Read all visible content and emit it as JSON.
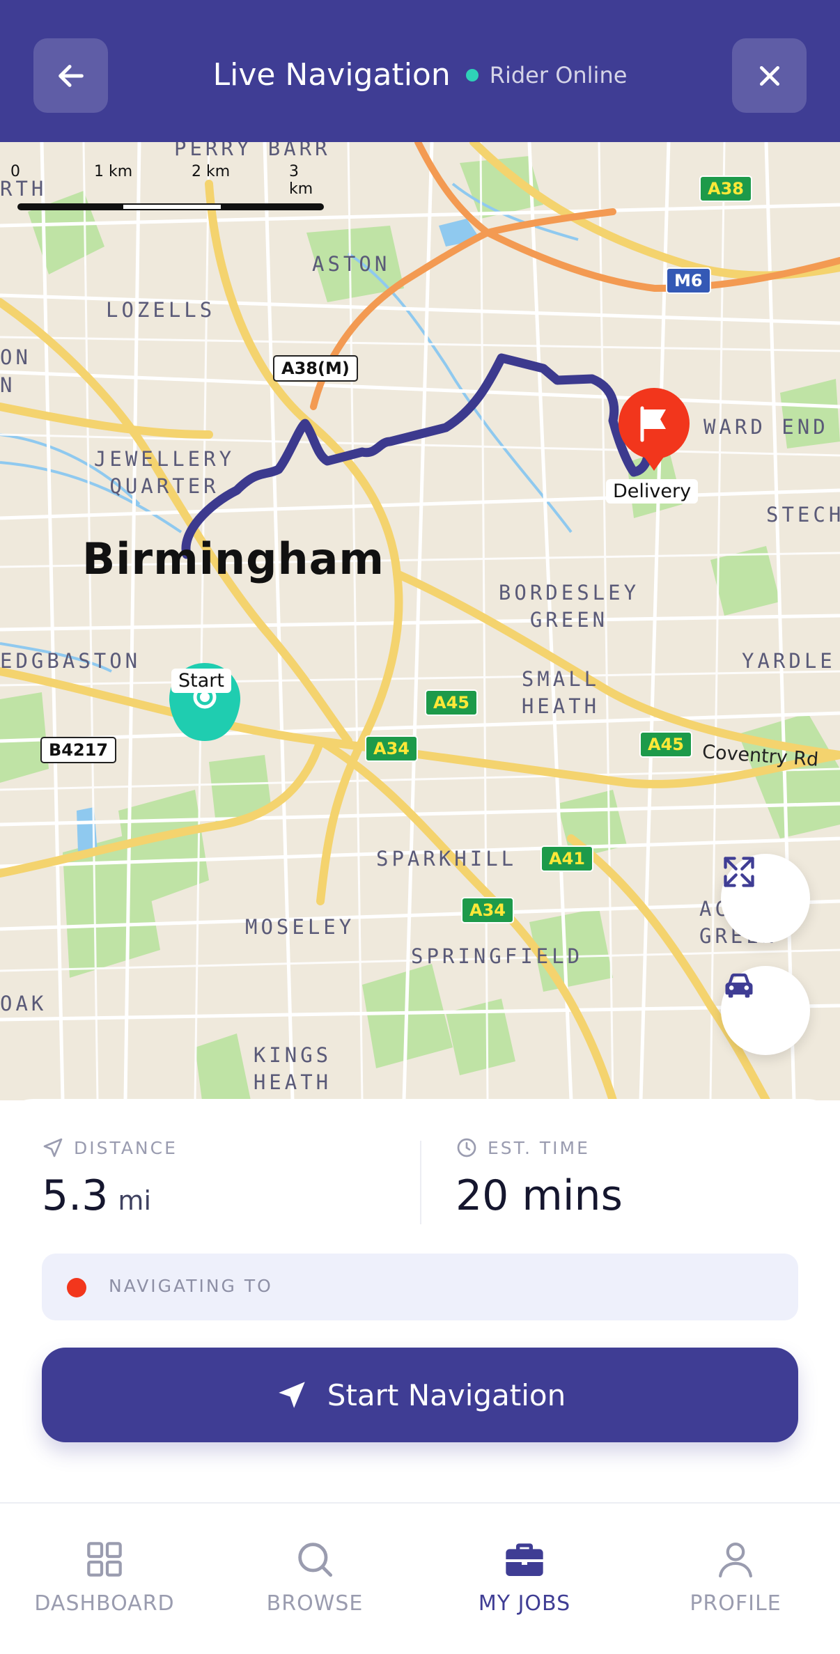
{
  "header": {
    "title": "Live Navigation",
    "status": "Rider Online",
    "back_icon": "arrow-left-icon",
    "close_icon": "close-icon"
  },
  "map": {
    "scale": {
      "labels": [
        "0",
        "1 km",
        "2 km",
        "3 km"
      ]
    },
    "city": "Birmingham",
    "areas": [
      "PERRY BARR",
      "ASTON",
      "LOZELLS",
      "JEWELLERY QUARTER",
      "BORDESLEY GREEN",
      "SMALL HEATH",
      "EDGBASTON",
      "SPARKHILL",
      "MOSELEY",
      "SPRINGFIELD",
      "KINGS HEATH",
      "WARD END",
      "STECH",
      "YARDLE",
      "ACOCKS GREEN",
      "OAK",
      "ON",
      "N",
      "RTH"
    ],
    "roads": [
      "A38",
      "M6",
      "A38(M)",
      "A45",
      "A34",
      "A45",
      "A41",
      "A34",
      "B4217"
    ],
    "road_name": "Coventry Rd",
    "start_label": "Start",
    "end_label": "Delivery",
    "route_color": "#3c3a8e",
    "start_color": "#1fcdb0",
    "end_color": "#f2361c"
  },
  "stats": {
    "distance_label": "DISTANCE",
    "distance_value": "5.3",
    "distance_unit": "mi",
    "time_label": "EST. TIME",
    "time_value": "20 mins"
  },
  "destination": {
    "label": "NAVIGATING TO"
  },
  "cta": {
    "label": "Start Navigation"
  },
  "nav": {
    "items": [
      {
        "label": "DASHBOARD",
        "icon": "grid-icon"
      },
      {
        "label": "BROWSE",
        "icon": "search-icon"
      },
      {
        "label": "MY JOBS",
        "icon": "briefcase-icon"
      },
      {
        "label": "PROFILE",
        "icon": "user-icon"
      }
    ],
    "active": "MY JOBS"
  },
  "colors": {
    "primary": "#3f3d94",
    "online": "#2fd1b8",
    "accent_red": "#f2361c"
  }
}
